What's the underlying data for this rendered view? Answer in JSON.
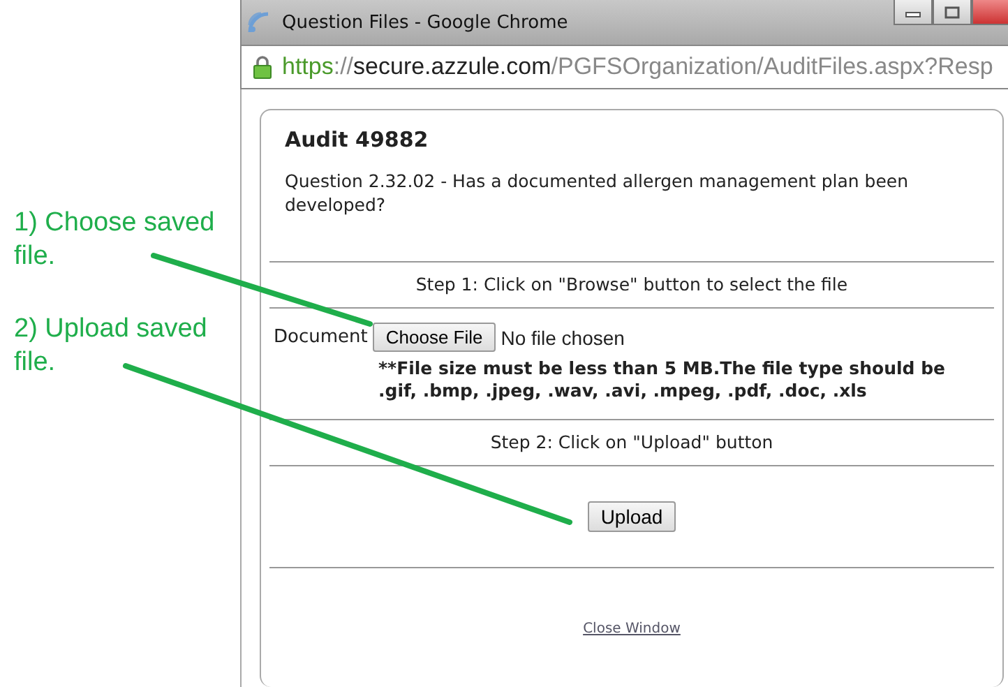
{
  "annotations": [
    {
      "text": "1) Choose saved file."
    },
    {
      "text": "2) Upload saved file."
    }
  ],
  "window": {
    "title": "Question Files - Google Chrome"
  },
  "address_bar": {
    "scheme": "https",
    "separator": "://",
    "host": "secure.azzule.com",
    "path": "/PGFSOrganization/AuditFiles.aspx?Resp"
  },
  "panel": {
    "title": "Audit 49882",
    "question": "Question 2.32.02 - Has a documented allergen management plan been developed?",
    "step1": "Step 1: Click on \"Browse\" button to select the file",
    "document_label": "Document",
    "choose_button": "Choose File",
    "file_status": "No file chosen",
    "note": "**File size must be less than 5 MB.The file type should be .gif, .bmp, .jpeg, .wav, .avi, .mpeg, .pdf, .doc, .xls",
    "step2": "Step 2: Click on \"Upload\" button",
    "upload_button": "Upload",
    "close_link": "Close Window"
  }
}
